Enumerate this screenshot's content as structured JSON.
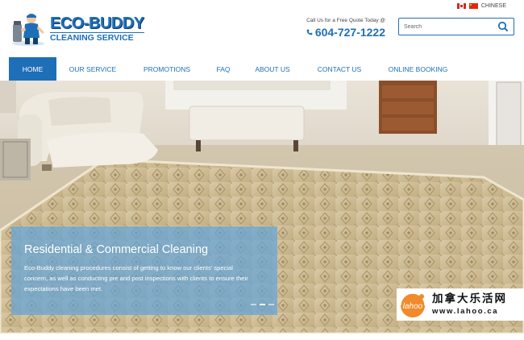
{
  "language": {
    "label": "CHINESE"
  },
  "logo": {
    "main": "ECO-BUDDY",
    "sub": "CLEANING SERVICE"
  },
  "header": {
    "call_label": "Call Us for a Free Quote Today @",
    "phone": "604-727-1222"
  },
  "search": {
    "placeholder": "Search"
  },
  "nav": {
    "items": [
      {
        "label": "HOME",
        "active": true
      },
      {
        "label": "OUR SERVICE"
      },
      {
        "label": "PROMOTIONS"
      },
      {
        "label": "FAQ"
      },
      {
        "label": "ABOUT US"
      },
      {
        "label": "CONTACT US"
      },
      {
        "label": "ONLINE BOOKING"
      }
    ]
  },
  "hero": {
    "title": "Residential & Commercial Cleaning",
    "text": "Eco-Buddy cleaning procedures consist of getting to know our clients' special concern, as well as conducting pre and post inspections with clients to ensure their expectations have been met.",
    "slides": 3,
    "active_slide": 2
  },
  "watermark": {
    "cn": "加拿大乐活网",
    "url": "www.lahoo.ca"
  },
  "colors": {
    "brand": "#1e6fb8",
    "caption_bg": "#62a3d8"
  }
}
